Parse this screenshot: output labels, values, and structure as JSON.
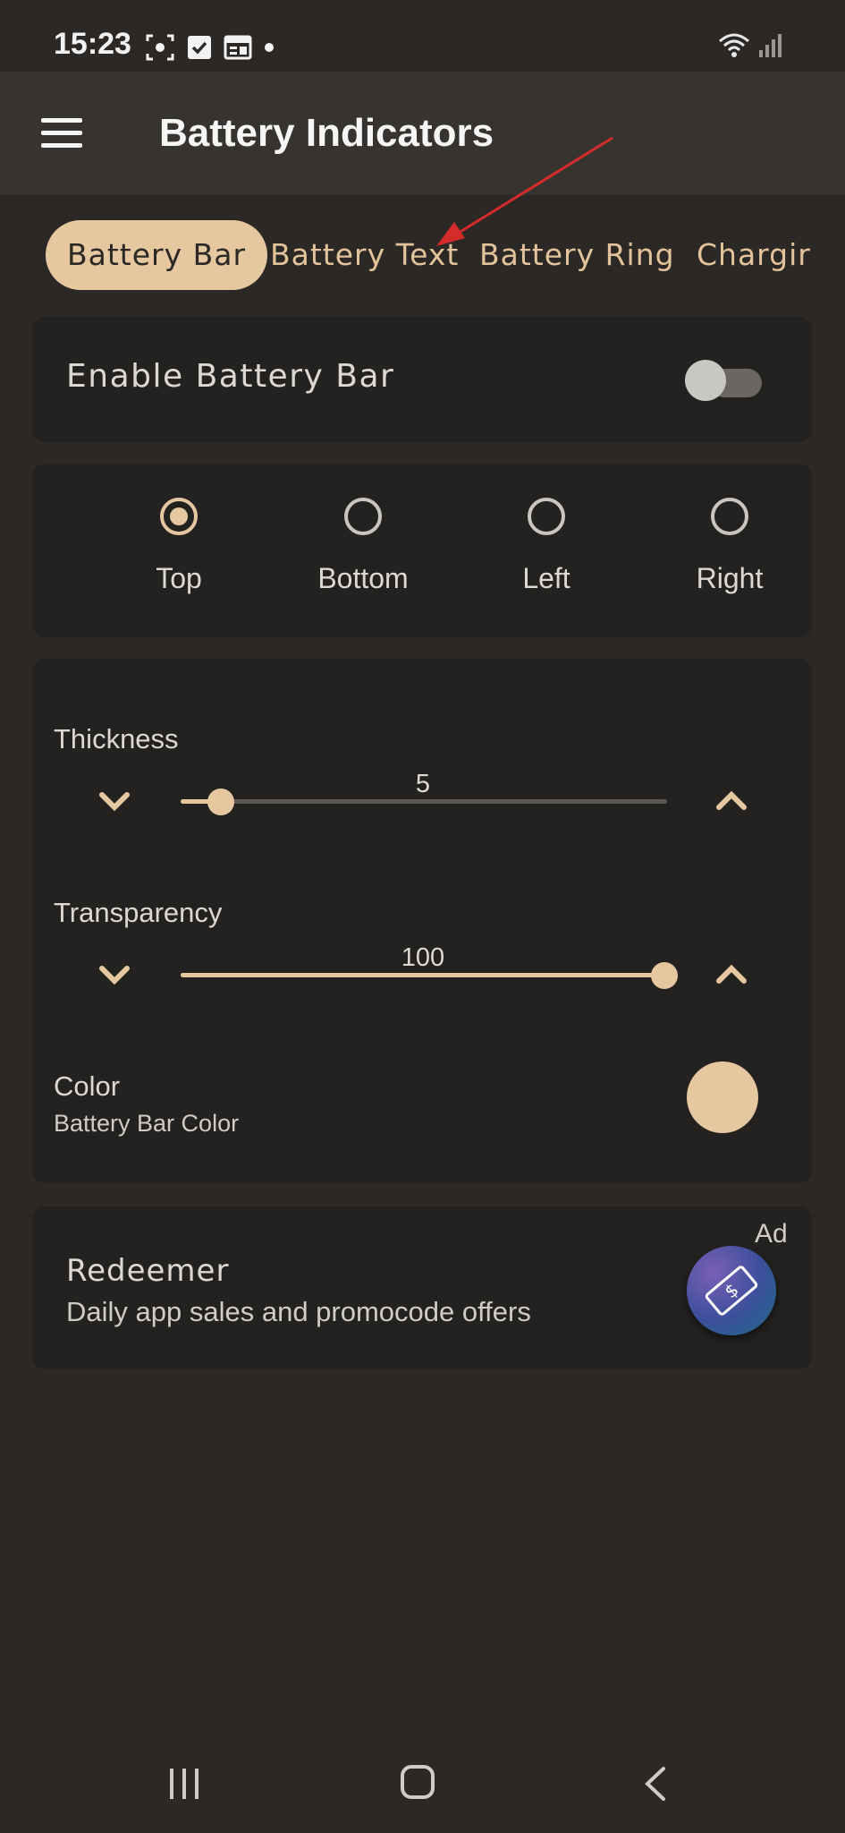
{
  "status_bar": {
    "time": "15:23"
  },
  "app_bar": {
    "title": "Battery Indicators"
  },
  "tabs": [
    {
      "label": "Battery Bar",
      "active": true
    },
    {
      "label": "Battery Text",
      "active": false
    },
    {
      "label": "Battery Ring",
      "active": false
    },
    {
      "label": "Chargir",
      "active": false
    }
  ],
  "enable_card": {
    "label": "Enable Battery Bar",
    "enabled": false
  },
  "position": {
    "options": [
      "Top",
      "Bottom",
      "Left",
      "Right"
    ],
    "selected": "Top"
  },
  "thickness": {
    "label": "Thickness",
    "value": "5"
  },
  "transparency": {
    "label": "Transparency",
    "value": "100"
  },
  "color": {
    "label": "Color",
    "sublabel": "Battery Bar Color",
    "value": "#e6c8a0"
  },
  "ad": {
    "title": "Redeemer",
    "subtitle": "Daily app sales and promocode offers",
    "tag": "Ad"
  },
  "colors": {
    "accent": "#e6c8a0",
    "background": "#2b2825",
    "card": "#242220",
    "appbar": "#373430",
    "annotation_arrow": "#d42b2b"
  }
}
